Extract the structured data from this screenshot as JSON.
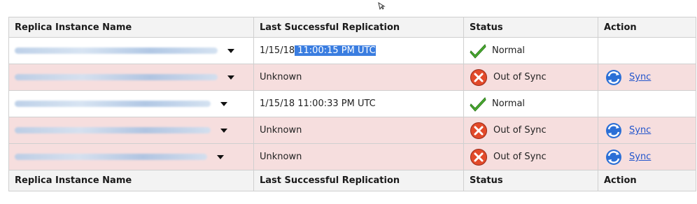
{
  "table": {
    "headers": [
      "Replica Instance Name",
      "Last Successful Replication",
      "Status",
      "Action"
    ],
    "footer": [
      "Replica Instance Name",
      "Last Successful Replication",
      "Status",
      "Action"
    ],
    "rows": [
      {
        "replication_date": "1/15/18",
        "replication_time": " 11:00:15 PM UTC",
        "status": "Normal",
        "status_icon": "check-icon",
        "action": ""
      },
      {
        "replication_date": "Unknown",
        "replication_time": "",
        "status": "Out of Sync",
        "status_icon": "error-icon",
        "action": "Sync"
      },
      {
        "replication_date": "1/15/18 11:00:33 PM UTC",
        "replication_time": "",
        "status": "Normal",
        "status_icon": "check-icon",
        "action": ""
      },
      {
        "replication_date": "Unknown",
        "replication_time": "",
        "status": "Out of Sync",
        "status_icon": "error-icon",
        "action": "Sync"
      },
      {
        "replication_date": "Unknown",
        "replication_time": "",
        "status": "Out of Sync",
        "status_icon": "error-icon",
        "action": "Sync"
      }
    ]
  },
  "colors": {
    "alt_row": "#f6dede",
    "header_bg": "#f3f3f3",
    "link": "#2255cc",
    "selection": "#3a7de0"
  }
}
